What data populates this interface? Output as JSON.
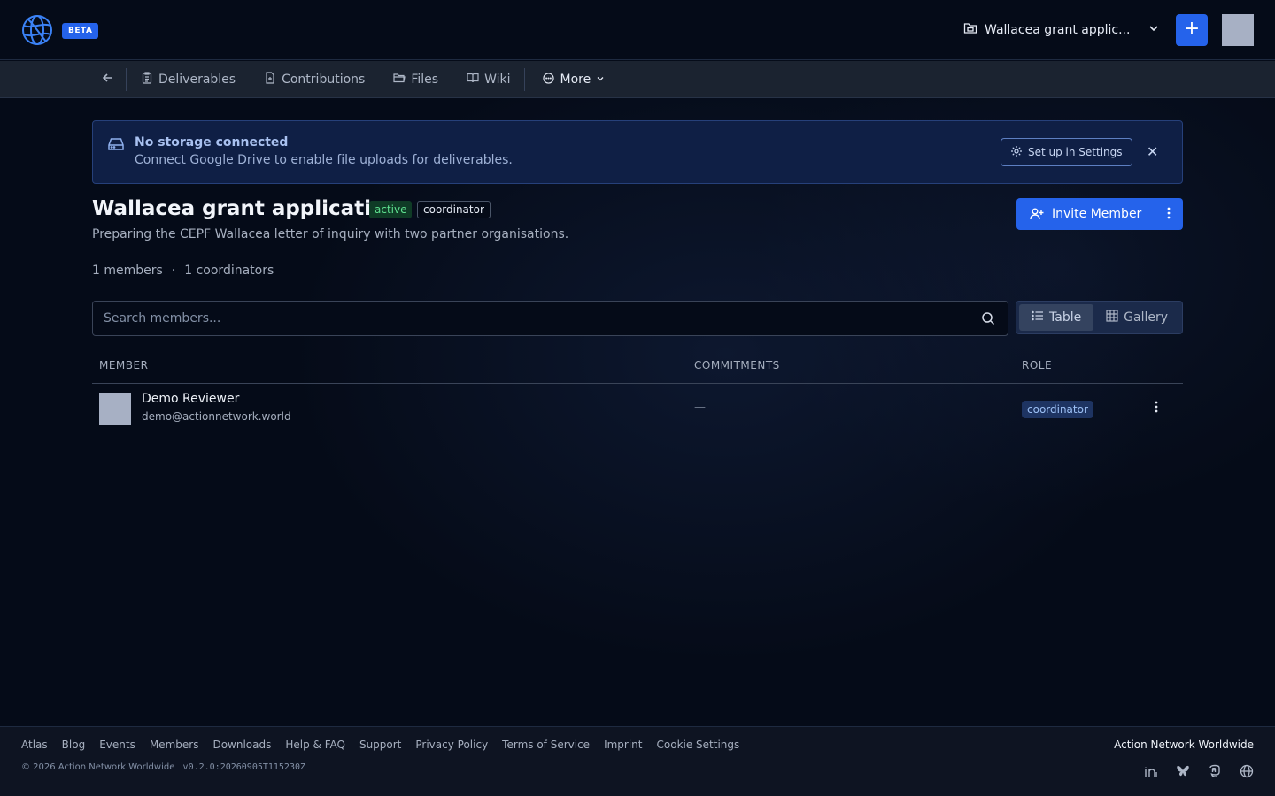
{
  "header": {
    "beta_label": "BETA",
    "project_name": "Wallacea grant applic...",
    "add_label": "+"
  },
  "subnav": {
    "items": [
      {
        "label": "Deliverables",
        "icon": "clipboard-icon"
      },
      {
        "label": "Contributions",
        "icon": "document-icon"
      },
      {
        "label": "Files",
        "icon": "folder-icon"
      },
      {
        "label": "Wiki",
        "icon": "book-icon"
      }
    ],
    "more_label": "More"
  },
  "banner": {
    "title": "No storage connected",
    "text": "Connect Google Drive to enable file uploads for deliverables.",
    "button_label": "Set up in Settings",
    "close": "✕"
  },
  "project": {
    "title": "Wallacea grant application",
    "status_badge": "active",
    "role_badge": "coordinator",
    "description": "Preparing the CEPF Wallacea letter of inquiry with two partner organisations.",
    "invite_label": "Invite Member",
    "members_count": "1 members",
    "separator": "·",
    "coordinators_count": "1 coordinators"
  },
  "search": {
    "placeholder": "Search members...",
    "value": ""
  },
  "view_toggle": {
    "table_label": "Table",
    "gallery_label": "Gallery",
    "selected": "Table"
  },
  "table": {
    "columns": [
      "MEMBER",
      "COMMITMENTS",
      "ROLE"
    ],
    "rows": [
      {
        "name": "Demo Reviewer",
        "email": "demo@actionnetwork.world",
        "commitments": "—",
        "role": "coordinator"
      }
    ]
  },
  "footer": {
    "links": [
      "Atlas",
      "Blog",
      "Events",
      "Members",
      "Downloads",
      "Help & FAQ",
      "Support",
      "Privacy Policy",
      "Terms of Service",
      "Imprint",
      "Cookie Settings"
    ],
    "copyright": "© 2026 Action Network Worldwide",
    "version": "v0.2.0:20260905T115230Z",
    "brand": "Action Network Worldwide"
  },
  "colors": {
    "accent": "#2563eb",
    "background": "#050b18",
    "banner_bg": "#0f1f45",
    "active_badge": "#5ee08f"
  }
}
